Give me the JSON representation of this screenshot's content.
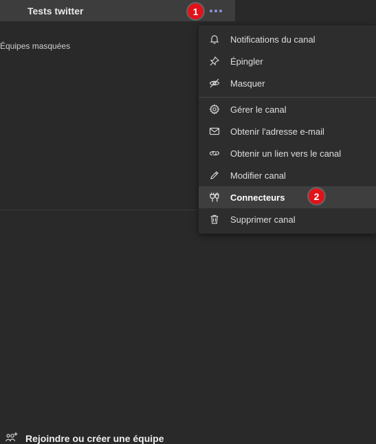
{
  "channel": {
    "name": "Tests twitter",
    "more_icon": "more-options-icon"
  },
  "sidebar": {
    "hidden_teams_label": "Équipes masquées",
    "join_label": "Rejoindre ou créer une équipe",
    "join_icon": "join-team-icon"
  },
  "menu": {
    "items": [
      {
        "label": "Notifications du canal",
        "icon": "bell-icon"
      },
      {
        "label": "Épingler",
        "icon": "pin-icon"
      },
      {
        "label": "Masquer",
        "icon": "eye-off-icon"
      },
      {
        "label": "Gérer le canal",
        "icon": "gear-icon"
      },
      {
        "label": "Obtenir l'adresse e-mail",
        "icon": "mail-icon"
      },
      {
        "label": "Obtenir un lien vers le canal",
        "icon": "link-icon"
      },
      {
        "label": "Modifier canal",
        "icon": "pencil-icon"
      },
      {
        "label": "Connecteurs",
        "icon": "connectors-icon",
        "highlighted": true
      },
      {
        "label": "Supprimer canal",
        "icon": "trash-icon"
      }
    ]
  },
  "annotations": {
    "badge_1": "1",
    "badge_2": "2"
  },
  "colors": {
    "accent": "#8f94d6",
    "badge": "#e1131a",
    "background": "#292929",
    "menu_background": "#2d2d2d"
  }
}
